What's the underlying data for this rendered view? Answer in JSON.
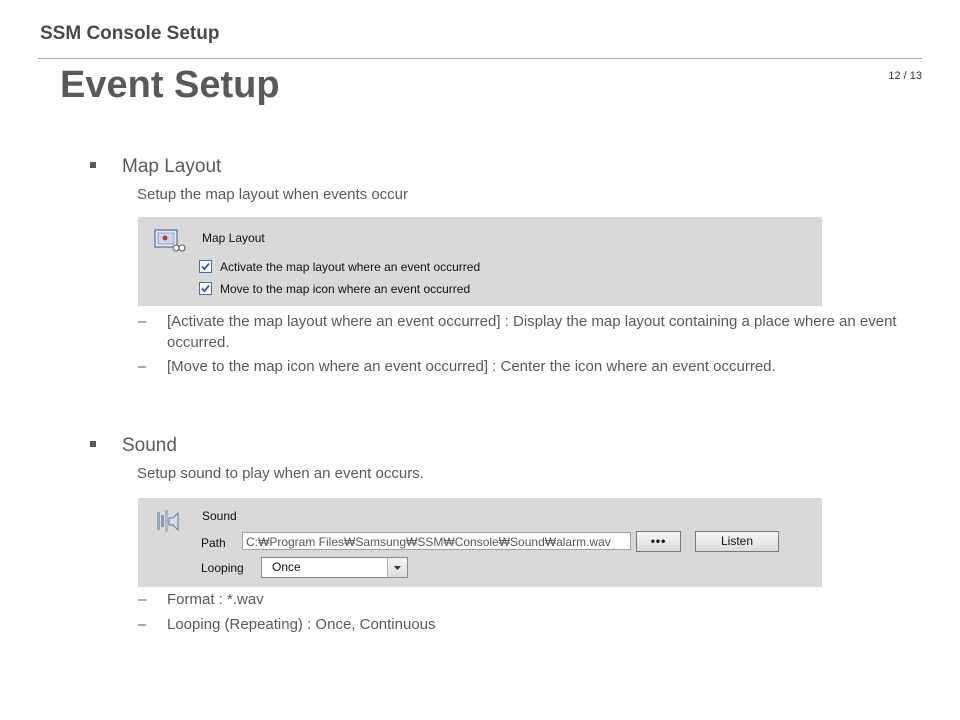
{
  "header": {
    "section": "SSM Console Setup",
    "page": "12 / 13"
  },
  "title": "Event Setup",
  "map_layout": {
    "heading": "Map Layout",
    "description": "Setup the map layout when events occur",
    "panel": {
      "title": "Map Layout",
      "options": [
        {
          "label": "Activate the map layout where an event occurred",
          "checked": true
        },
        {
          "label": "Move to the map icon where an event occurred",
          "checked": true
        }
      ]
    },
    "notes": [
      {
        "dash": "–",
        "text": "[Activate the map layout where an event occurred] : Display the map layout containing a place where an event occurred."
      },
      {
        "dash": "–",
        "text": "[Move to the map icon where an event occurred] : Center the icon where an event occurred."
      }
    ]
  },
  "sound": {
    "heading": "Sound",
    "description": "Setup sound to play when an event occurs.",
    "panel": {
      "title": "Sound",
      "path_label": "Path",
      "path_value": "C:₩Program Files₩Samsung₩SSM₩Console₩Sound₩alarm.wav",
      "browse_label": "•••",
      "listen_label": "Listen",
      "looping_label": "Looping",
      "looping_value": "Once"
    },
    "notes": [
      {
        "dash": "–",
        "text": "Format : *.wav"
      },
      {
        "dash": "–",
        "text": "Looping (Repeating) : Once, Continuous"
      }
    ]
  },
  "icons": {
    "map": "map-layout-icon",
    "sound": "sound-speaker-icon",
    "check": "checkmark-icon",
    "dropdown": "dropdown-arrow-icon"
  }
}
